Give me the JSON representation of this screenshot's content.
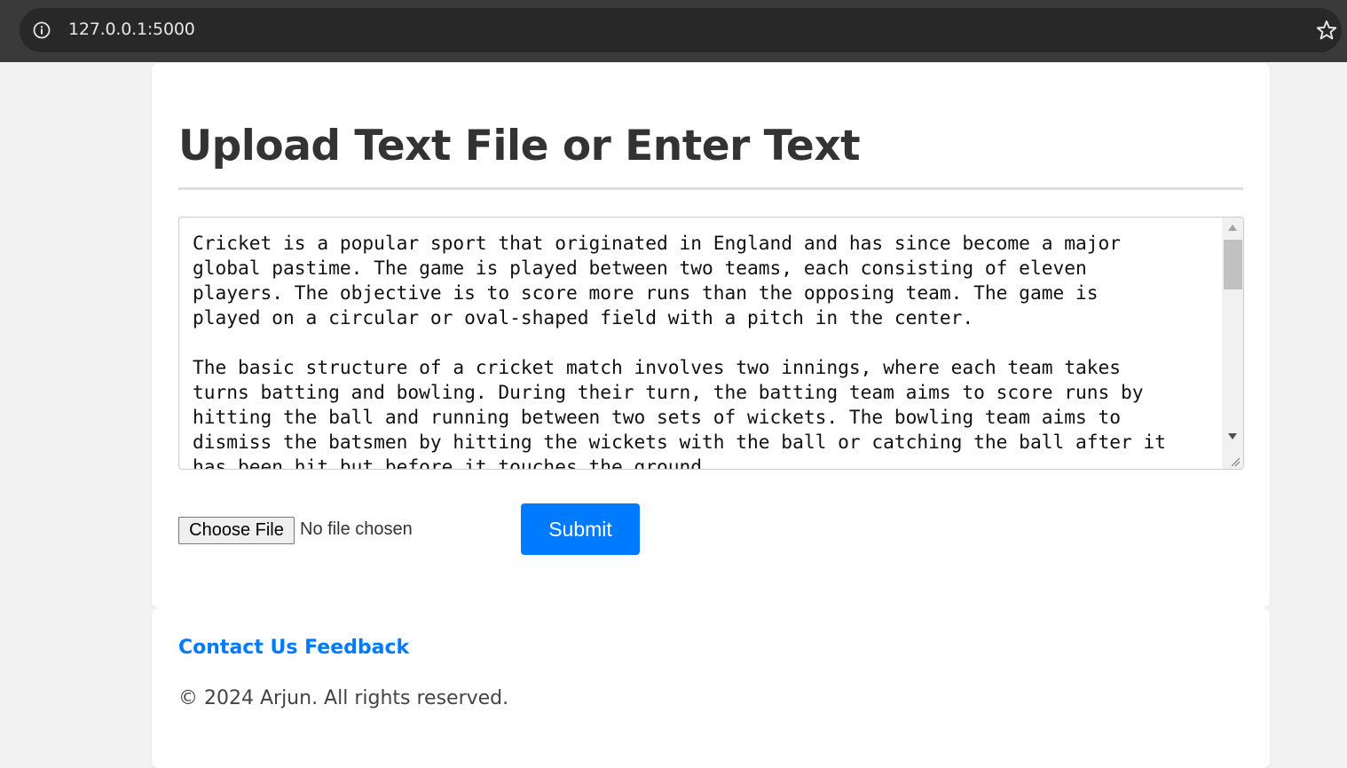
{
  "browser": {
    "url": "127.0.0.1:5000",
    "icons": [
      "info-icon",
      "star-icon"
    ]
  },
  "main": {
    "title": "Upload Text File or Enter Text",
    "textarea_value": "Cricket is a popular sport that originated in England and has since become a major\nglobal pastime. The game is played between two teams, each consisting of eleven\nplayers. The objective is to score more runs than the opposing team. The game is\nplayed on a circular or oval-shaped field with a pitch in the center.\n\nThe basic structure of a cricket match involves two innings, where each team takes\nturns batting and bowling. During their turn, the batting team aims to score runs by\nhitting the ball and running between two sets of wickets. The bowling team aims to\ndismiss the batsmen by hitting the wickets with the ball or catching the ball after it\nhas been hit but before it touches the ground.",
    "file_button_label": "Choose File",
    "file_status": "No file chosen",
    "submit_label": "Submit"
  },
  "footer": {
    "contact_link": "Contact Us",
    "feedback_link": "Feedback",
    "copyright": "© 2024 Arjun. All rights reserved."
  },
  "colors": {
    "accent": "#007bff",
    "title_text": "#333333",
    "page_bg": "#f2f2f2"
  }
}
